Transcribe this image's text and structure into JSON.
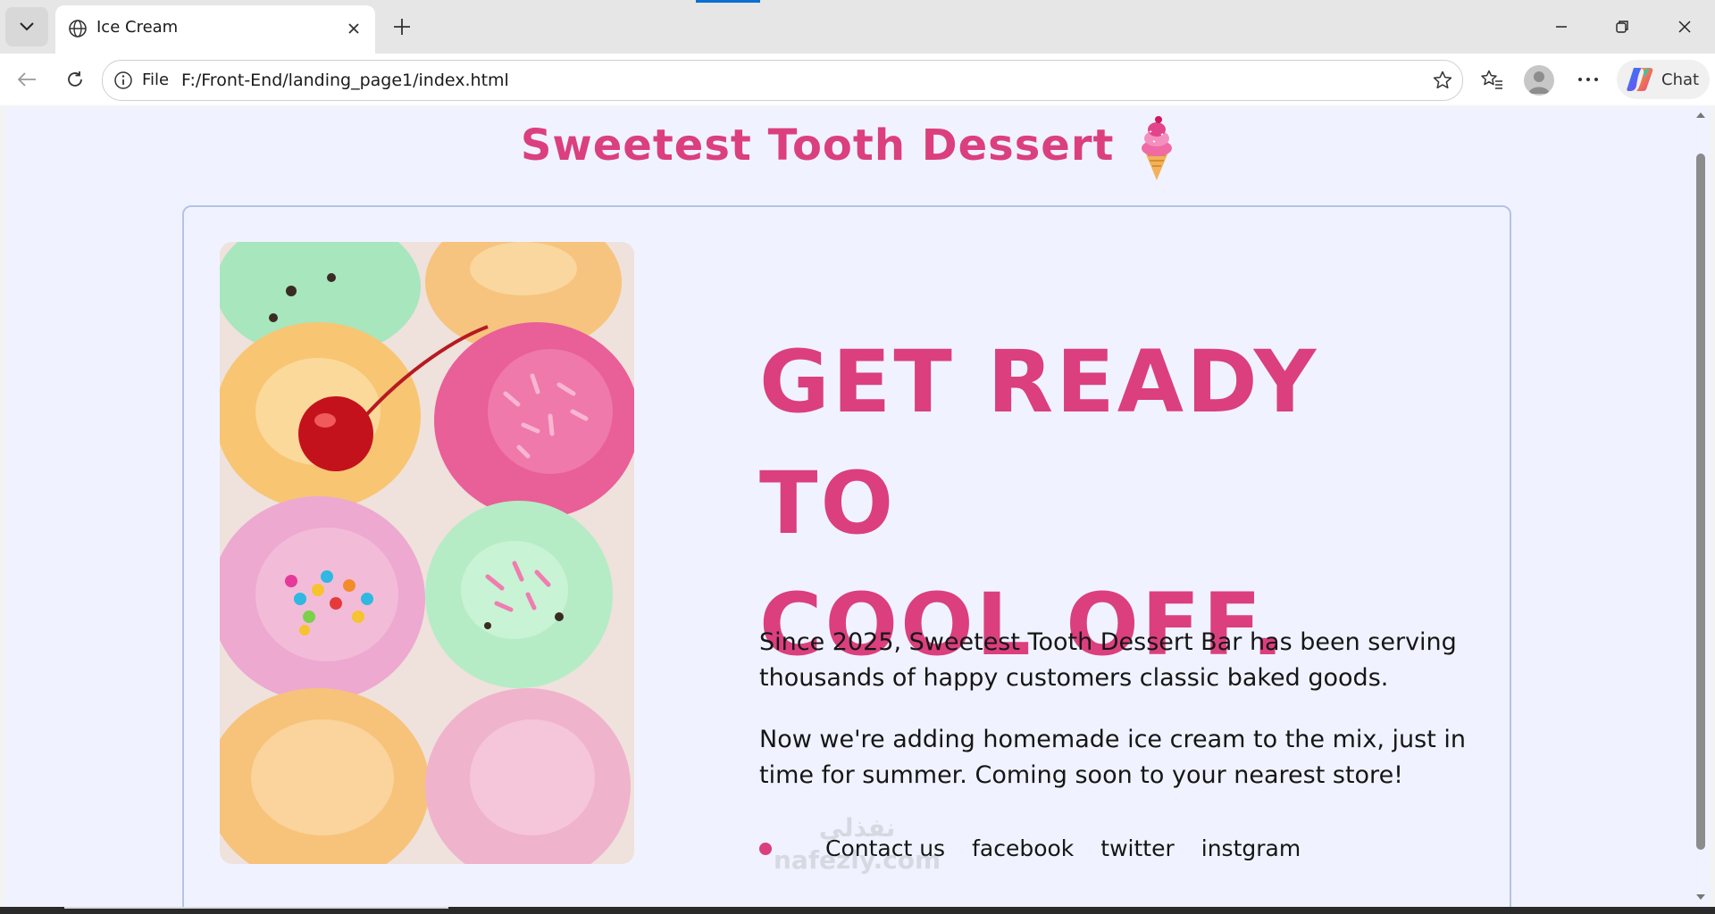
{
  "browser": {
    "tab_title": "Ice Cream",
    "address_scheme": "File",
    "address_url": "F:/Front-End/landing_page1/index.html",
    "chat_label": "Chat"
  },
  "page": {
    "site_title": "Sweetest Tooth Dessert",
    "headline_line1": "GET READY TO",
    "headline_line2": "COOL OFF.",
    "paragraph1": "Since 2025, Sweetest Tooth Dessert Bar has been serving thousands of happy customers classic baked goods.",
    "paragraph2": "Now we're adding homemade ice cream to the mix, just in time for summer. Coming soon to your nearest store!",
    "links": [
      "Contact us",
      "facebook",
      "twitter",
      "instgram"
    ],
    "watermark": "نفذلي",
    "watermark_domain": "nafezly.com"
  },
  "colors": {
    "accent_pink": "#db3f7e",
    "page_bg": "#f0f3ff",
    "card_border": "#b6c2e6"
  },
  "icons": [
    "tab-list-icon",
    "globe-icon",
    "close-icon",
    "plus-icon",
    "minimize-icon",
    "restore-icon",
    "window-close-icon",
    "back-icon",
    "reload-icon",
    "info-icon",
    "star-icon",
    "favorites-icon",
    "profile-icon",
    "more-icon",
    "copilot-icon",
    "ice-cream-cone-icon"
  ]
}
